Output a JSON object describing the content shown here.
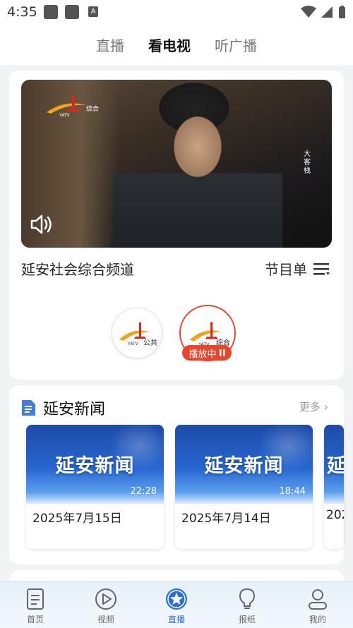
{
  "status_bar": {
    "time": "4:35",
    "a_badge": "A"
  },
  "top_tabs": [
    {
      "label": "直播",
      "active": false
    },
    {
      "label": "看电视",
      "active": true
    },
    {
      "label": "听广播",
      "active": false
    }
  ],
  "player": {
    "overlay_vertical_text": "大客栈",
    "watermark_text": "综合",
    "channel_title": "延安社会综合频道",
    "program_list_label": "节目单"
  },
  "channels": [
    {
      "name": "公共",
      "logo_text": "YATV"
    },
    {
      "name": "综合",
      "logo_text": "YATV",
      "active": true
    }
  ],
  "playing_badge": "播放中",
  "news": {
    "title": "延安新闻",
    "more_label": "更多",
    "items": [
      {
        "thumb_title": "延安新闻",
        "duration": "22:28",
        "date": "2025年7月15日"
      },
      {
        "thumb_title": "延安新闻",
        "duration": "18:44",
        "date": "2025年7月14日"
      },
      {
        "thumb_title": "延",
        "duration": "",
        "date": "202"
      }
    ]
  },
  "bottom_tabs": [
    {
      "label": "首页",
      "icon": "document-icon"
    },
    {
      "label": "视频",
      "icon": "play-icon"
    },
    {
      "label": "直播",
      "icon": "star-icon",
      "active": true
    },
    {
      "label": "报纸",
      "icon": "lightbulb-icon"
    },
    {
      "label": "我的",
      "icon": "person-icon"
    }
  ],
  "colors": {
    "accent": "#2a6fd9",
    "live_red": "#e8452a",
    "logo_red": "#d8281e",
    "logo_yellow": "#f0a320"
  }
}
